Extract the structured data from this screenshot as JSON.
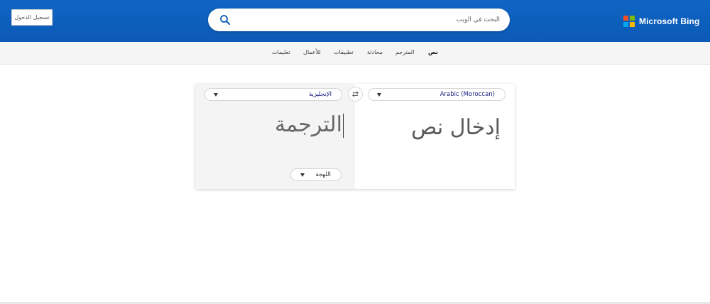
{
  "header": {
    "signin_label": "تسجيل الدخول",
    "search_placeholder": "البحث في الويب",
    "logo_text": "Microsoft Bing",
    "logo_colors": [
      "#f25022",
      "#7fba00",
      "#00a4ef",
      "#ffb900"
    ],
    "brand_color": "#0b5ab6"
  },
  "nav": {
    "items": [
      {
        "label": "نص",
        "active": true
      },
      {
        "label": "المترجم",
        "active": false
      },
      {
        "label": "محادثة",
        "active": false
      },
      {
        "label": "تطبيقات",
        "active": false
      },
      {
        "label": "للأعمال",
        "active": false
      },
      {
        "label": "تعليمات",
        "active": false
      }
    ]
  },
  "translator": {
    "source_language": "Arabic (Moroccan)",
    "target_language": "الإنجليزية",
    "input_placeholder": "إدخال نص",
    "output_placeholder": "الترجمة",
    "dialect_label": "اللهجة",
    "swap_icon": "swap-icon"
  }
}
